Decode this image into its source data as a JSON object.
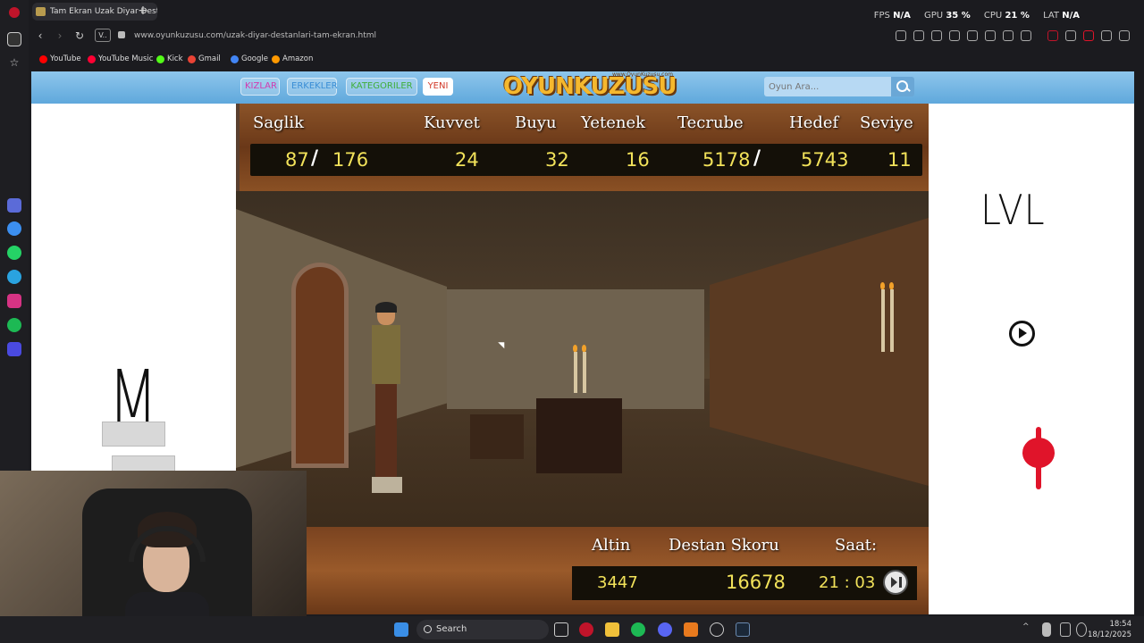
{
  "browser": {
    "tab_title": "Tam Ekran Uzak Diyar Dest",
    "url": "www.oyunkuzusu.com/uzak-diyar-destanlari-tam-ekran.html",
    "url_badge": "V..",
    "stats": {
      "fps_label": "FPS",
      "fps_value": "N/A",
      "gpu_label": "GPU",
      "gpu_value": "35 %",
      "cpu_label": "CPU",
      "cpu_value": "21 %",
      "lat_label": "LAT",
      "lat_value": "N/A"
    },
    "bookmarks": [
      {
        "label": "YouTube",
        "color": "#ff0000"
      },
      {
        "label": "YouTube Music",
        "color": "#ff0033"
      },
      {
        "label": "Kick",
        "color": "#53fc18"
      },
      {
        "label": "Gmail",
        "color": "#ea4335"
      },
      {
        "label": "Google",
        "color": "#4285f4"
      },
      {
        "label": "Amazon",
        "color": "#ff9900"
      }
    ]
  },
  "site": {
    "nav": [
      "KIZLAR",
      "ERKEKLER",
      "KATEGORILER",
      "YENI"
    ],
    "logo_text": "OYUNKUZUSU",
    "logo_small": "www.OyunKuzusu.com",
    "search_placeholder": "Oyun Ara..."
  },
  "game": {
    "top_labels": [
      "Saglik",
      "Kuvvet",
      "Buyu",
      "Yetenek",
      "Tecrube",
      "Hedef",
      "Seviye"
    ],
    "health_current": "87",
    "health_max": "176",
    "strength": "24",
    "magic": "32",
    "skill": "16",
    "experience": "5178",
    "target": "5743",
    "level": "11",
    "bottom_labels": [
      "Altin",
      "Destan Skoru",
      "Saat:"
    ],
    "gold": "3447",
    "epic_score": "16678",
    "time": "21 : 03"
  },
  "annotations": {
    "lvl": "LVL",
    "m": "M"
  },
  "taskbar": {
    "search_label": "Search",
    "time": "18:54",
    "date": "18/12/2025"
  }
}
